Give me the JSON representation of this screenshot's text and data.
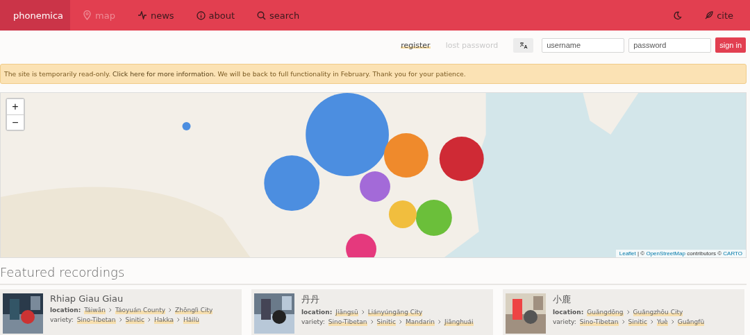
{
  "navbar": {
    "brand": "phonemica",
    "items": [
      {
        "label": "map",
        "disabled": true
      },
      {
        "label": "news",
        "disabled": false
      },
      {
        "label": "about",
        "disabled": false
      },
      {
        "label": "search",
        "disabled": false
      }
    ],
    "right": [
      {
        "kind": "toggle"
      },
      {
        "kind": "link",
        "label": "cite"
      }
    ]
  },
  "auth": {
    "links": [
      {
        "label": "register",
        "disabled": false
      },
      {
        "label": "lost password",
        "disabled": true
      }
    ],
    "username": {
      "placeholder": "username"
    },
    "password": {
      "placeholder": "password"
    },
    "submit": "sign in"
  },
  "alert": {
    "before": "The site is temporarily read-only.",
    "link": "Click here for more information.",
    "after": "We will be back to full functionality in February. Thank you for your patience."
  },
  "map": {
    "kind": "picture",
    "zoom_in": "+",
    "zoom_out": "−",
    "attribution": [
      {
        "text": "Leaflet",
        "kind": "link"
      },
      {
        "text": "| ©",
        "kind": "text"
      },
      {
        "text": "OpenStreetMap",
        "kind": "link"
      },
      {
        "text": "contributors ©",
        "kind": "text"
      },
      {
        "text": "CARTO",
        "kind": "link"
      }
    ]
  },
  "featured": {
    "heading": "Featured recordings",
    "recordings": [
      {
        "title": "Rhiap Giau Giau",
        "location_label": "location:",
        "location": [
          "Táiwān",
          "Táoyuán County",
          "Zhōnglì City"
        ],
        "variety_label": "variety:",
        "variety": [
          "Sino-Tibetan",
          "Sinitic",
          "Hakka",
          "Hǎilù"
        ]
      },
      {
        "title": "丹丹",
        "location_label": "location:",
        "location": [
          "Jiāngsū",
          "Liányúngǎng City"
        ],
        "variety_label": "variety:",
        "variety": [
          "Sino-Tibetan",
          "Sinitic",
          "Mandarin",
          "Jiānghuái"
        ]
      },
      {
        "title": "小鹿",
        "location_label": "location:",
        "location": [
          "Guǎngdōng",
          "Guǎngzhōu City"
        ],
        "variety_label": "variety:",
        "variety": [
          "Sino-Tibetan",
          "Sinitic",
          "Yuè",
          "Guǎngfǔ"
        ]
      }
    ]
  }
}
